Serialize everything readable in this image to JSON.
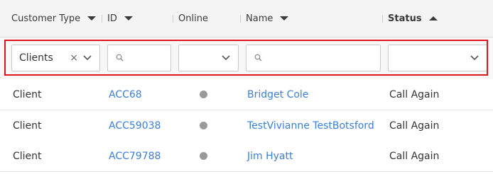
{
  "columns": {
    "customer_type": "Customer Type",
    "id": "ID",
    "online": "Online",
    "name": "Name",
    "status": "Status"
  },
  "filters": {
    "customer_type_value": "Clients",
    "clear_symbol": "×"
  },
  "rows": [
    {
      "type": "Client",
      "id": "ACC68",
      "name": "Bridget Cole",
      "status": "Call Again"
    },
    {
      "type": "Client",
      "id": "ACC59038",
      "name": "TestVivianne TestBotsford",
      "status": "Call Again"
    },
    {
      "type": "Client",
      "id": "ACC79788",
      "name": "Jim Hyatt",
      "status": "Call Again"
    }
  ],
  "colors": {
    "link": "#3b7fd6",
    "highlight": "#e0141e",
    "online_dot": "#999999"
  }
}
